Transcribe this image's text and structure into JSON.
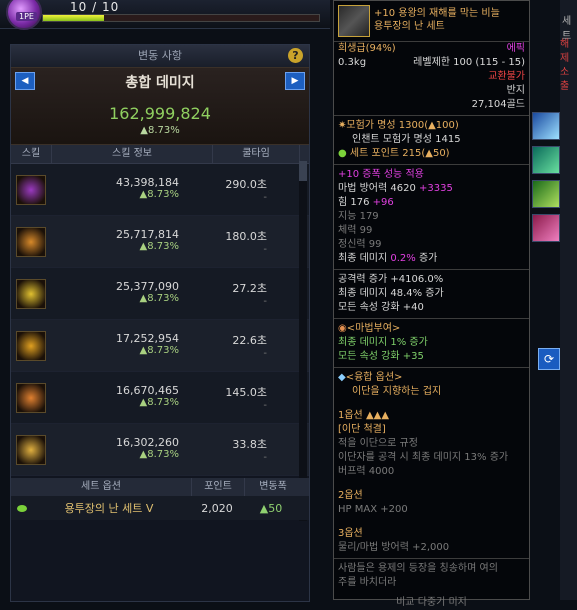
{
  "topbar": {
    "hp_text": "10 / 10",
    "level_badge": "1PE"
  },
  "panel": {
    "title": "변동 사항",
    "help": "?",
    "total_label": "총합 데미지",
    "total_value": "162,999,824",
    "total_rate": "▲8.73%",
    "prev_arrow": "◀",
    "next_arrow": "▶",
    "columns": [
      "스킬",
      "스킬 정보",
      "쿨타임"
    ],
    "skills": [
      {
        "damage": "43,398,184",
        "rate": "▲8.73%",
        "cooldown": "290.0초",
        "cd_change": "-",
        "color": "#9a3ac0"
      },
      {
        "damage": "25,717,814",
        "rate": "▲8.73%",
        "cooldown": "180.0초",
        "cd_change": "-",
        "color": "#d7892a"
      },
      {
        "damage": "25,377,090",
        "rate": "▲8.73%",
        "cooldown": "27.2초",
        "cd_change": "-",
        "color": "#e0c030"
      },
      {
        "damage": "17,252,954",
        "rate": "▲8.73%",
        "cooldown": "22.6초",
        "cd_change": "-",
        "color": "#e0a020"
      },
      {
        "damage": "16,670,465",
        "rate": "▲8.73%",
        "cooldown": "145.0초",
        "cd_change": "-",
        "color": "#e08030"
      },
      {
        "damage": "16,302,260",
        "rate": "▲8.73%",
        "cooldown": "33.8초",
        "cd_change": "-",
        "color": "#e0b040"
      }
    ],
    "set_columns": [
      "세트 옵션",
      "포인트",
      "변동폭"
    ],
    "set": {
      "name": "용투장의 난 세트 V",
      "points": "2,020",
      "change": "▲50"
    }
  },
  "tooltip": {
    "title1": "+10 용왕의 재해를 막는 비늘",
    "title2": "용투장의 난 세트",
    "rarity": "희생급(94%)",
    "grade": "에픽",
    "weight": "0.3kg",
    "level_req": "레벨제한 100 (115 - 15)",
    "trade": "교환불가",
    "slot": "반지",
    "price": "27,104골드",
    "fame": "모험가 명성 1300(▲100)",
    "enchant_fame": "인챈트 모험가 명성 1415",
    "set_point": "세트 포인트 215(▲50)",
    "amplify": "+10 증폭 성능 적용",
    "magic_def": "마법 방어력 4620",
    "magic_def_bonus": "+3335",
    "str": "힘 176",
    "str_bonus": "+96",
    "int": "지능 179",
    "vit": "체력 99",
    "spirit": "정신력 99",
    "final_dmg": "최종 데미지",
    "final_dmg_val": "0.2%",
    "final_dmg_suffix": "증가",
    "atk_inc": "공격력 증가 +4106.0%",
    "final_inc": "최종 데미지 48.4% 증가",
    "elem": "모든 속성 강화 +40",
    "magic_title": "<마법부여>",
    "magic_final": "최종 데미지 1% 증가",
    "magic_elem": "모든 속성 강화 +35",
    "fusion_title": "<융합 옵션>",
    "fusion_sub": "이단을 지향하는 겁지",
    "opt1_label": "1옵션",
    "opt1_stars": "▲▲▲",
    "opt1_name": "[이단 척결]",
    "opt1_l1": "적을 이단으로 규정",
    "opt1_l2": "이단자를 공격 시 최종 데미지 13% 증가",
    "opt1_l3": "버프력 4000",
    "opt2_label": "2옵션",
    "opt2_l1": "HP MAX +200",
    "opt3_label": "3옵션",
    "opt3_l1": "물리/마법 방어력 +2,000",
    "flavor1": "사람들은 용제의 등장을 칭송하며 여의",
    "flavor2": "주를 바치더라",
    "footer": "비교 다중기 미지"
  },
  "right": {
    "red1": "해제",
    "red2": "소출",
    "tab": "세트"
  }
}
